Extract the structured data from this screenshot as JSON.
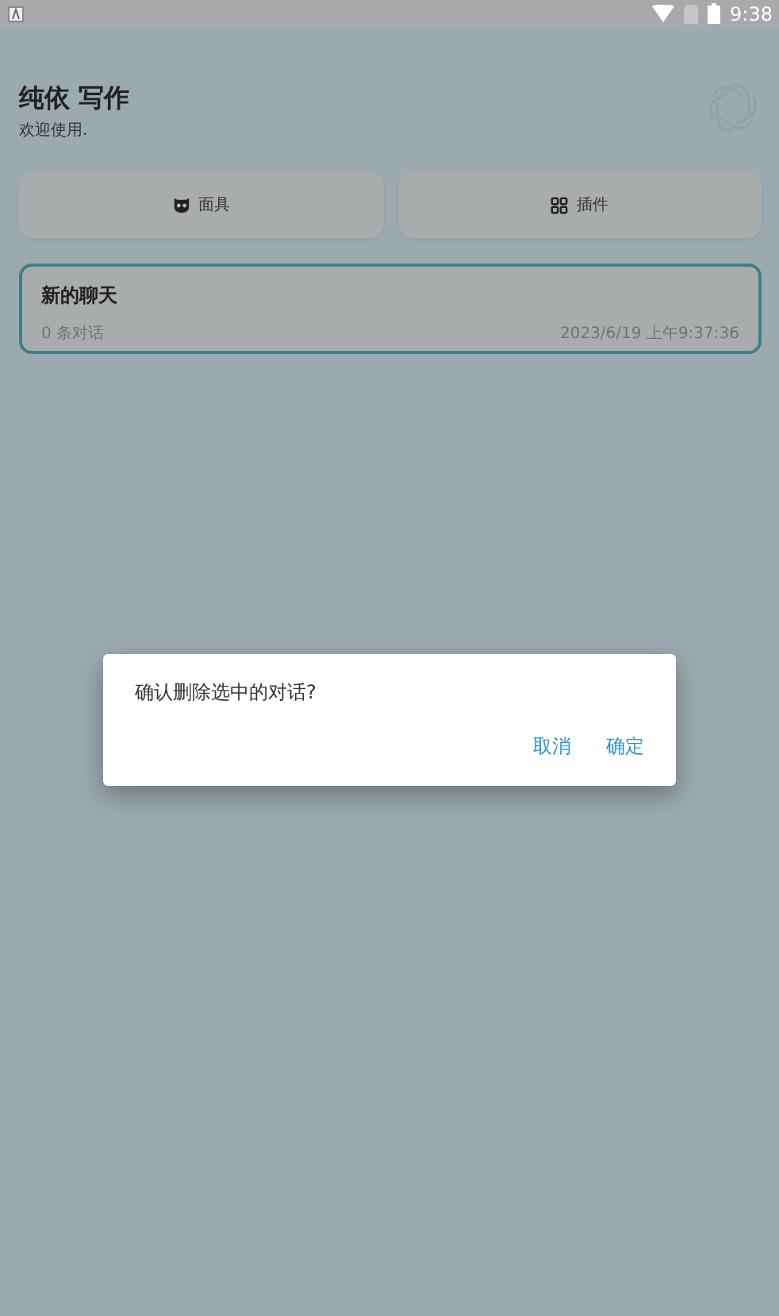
{
  "status_bar": {
    "time": "9:38"
  },
  "header": {
    "title": "纯依 写作",
    "subtitle": "欢迎使用."
  },
  "actions": [
    {
      "kind": "mask",
      "label": "面具"
    },
    {
      "kind": "plugins",
      "label": "插件"
    }
  ],
  "chats": [
    {
      "title": "新的聊天",
      "count": "0 条对话",
      "time": "2023/6/19 上午9:37:36",
      "selected": true
    }
  ],
  "dialog": {
    "message": "确认删除选中的对话?",
    "buttons": [
      "取消",
      "确定"
    ]
  }
}
